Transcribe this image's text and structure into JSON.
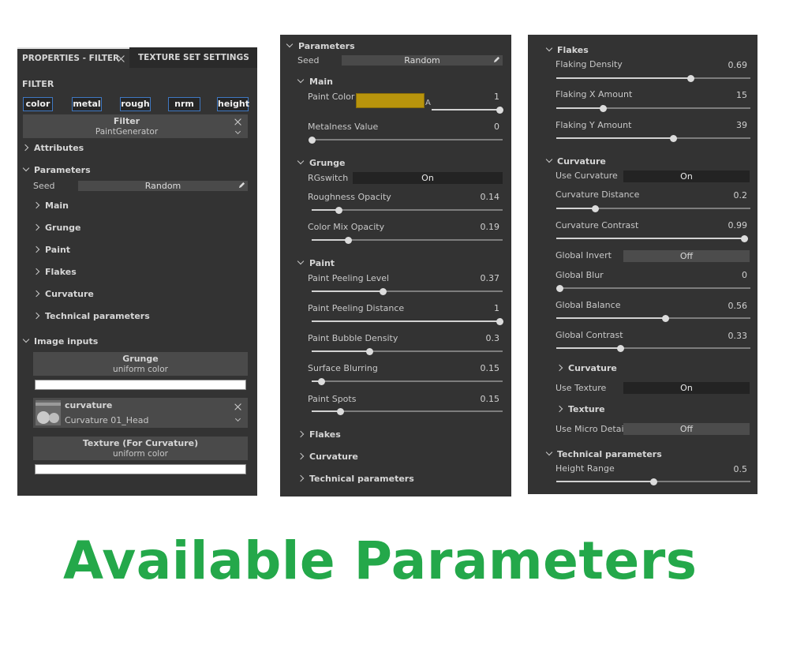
{
  "panel1": {
    "tabs": [
      "PROPERTIES - FILTER",
      "TEXTURE SET SETTINGS"
    ],
    "filter_heading": "FILTER",
    "channels": [
      "color",
      "metal",
      "rough",
      "nrm",
      "height"
    ],
    "filter_box": {
      "label": "Filter",
      "value": "PaintGenerator"
    },
    "sections": {
      "attributes": "Attributes",
      "parameters": "Parameters"
    },
    "seed": {
      "label": "Seed",
      "value": "Random"
    },
    "param_groups": [
      "Main",
      "Grunge",
      "Paint",
      "Flakes",
      "Curvature",
      "Technical parameters"
    ],
    "image_inputs": {
      "heading": "Image inputs",
      "grunge": {
        "title": "Grunge",
        "value": "uniform color"
      },
      "curvature": {
        "title": "curvature",
        "value": "Curvature 01_Head"
      },
      "texture": {
        "title": "Texture (For Curvature)",
        "value": "uniform color"
      }
    }
  },
  "panel2": {
    "parameters": "Parameters",
    "seed": {
      "label": "Seed",
      "value": "Random"
    },
    "main": {
      "heading": "Main",
      "paint_color": {
        "label": "Paint Color",
        "alpha_label": "A",
        "alpha_value": "1",
        "alpha": 1.0,
        "swatch": "#b8940c"
      },
      "metalness": {
        "label": "Metalness Value",
        "value": "0",
        "fraction": 0
      }
    },
    "grunge": {
      "heading": "Grunge",
      "rgswitch": {
        "label": "RGswitch",
        "value": "On"
      },
      "roughness_opacity": {
        "label": "Roughness Opacity",
        "value": "0.14",
        "fraction": 0.14
      },
      "color_mix_opacity": {
        "label": "Color Mix Opacity",
        "value": "0.19",
        "fraction": 0.19
      }
    },
    "paint": {
      "heading": "Paint",
      "peeling_level": {
        "label": "Paint Peeling Level",
        "value": "0.37",
        "fraction": 0.37
      },
      "peeling_distance": {
        "label": "Paint Peeling Distance",
        "value": "1",
        "fraction": 1.0
      },
      "bubble_density": {
        "label": "Paint Bubble Density",
        "value": "0.3",
        "fraction": 0.3
      },
      "surface_blurring": {
        "label": "Surface Blurring",
        "value": "0.15",
        "fraction": 0.05
      },
      "paint_spots": {
        "label": "Paint Spots",
        "value": "0.15",
        "fraction": 0.15
      }
    },
    "collapsed": [
      "Flakes",
      "Curvature",
      "Technical parameters"
    ]
  },
  "panel3": {
    "flakes": {
      "heading": "Flakes",
      "density": {
        "label": "Flaking Density",
        "value": "0.69",
        "fraction": 0.69
      },
      "x_amount": {
        "label": "Flaking X Amount",
        "value": "15",
        "fraction": 0.24
      },
      "y_amount": {
        "label": "Flaking Y Amount",
        "value": "39",
        "fraction": 0.6
      }
    },
    "curvature": {
      "heading": "Curvature",
      "use_curvature": {
        "label": "Use Curvature",
        "value": "On"
      },
      "distance": {
        "label": "Curvature Distance",
        "value": "0.2",
        "fraction": 0.2
      },
      "contrast": {
        "label": "Curvature Contrast",
        "value": "0.99",
        "fraction": 0.99
      },
      "global_invert": {
        "label": "Global Invert",
        "value": "Off"
      },
      "global_blur": {
        "label": "Global Blur",
        "value": "0",
        "fraction": 0
      },
      "global_balance": {
        "label": "Global Balance",
        "value": "0.56",
        "fraction": 0.56
      },
      "global_contrast": {
        "label": "Global Contrast",
        "value": "0.33",
        "fraction": 0.33
      },
      "sub_curvature": "Curvature",
      "use_texture": {
        "label": "Use Texture",
        "value": "On"
      },
      "sub_texture": "Texture",
      "use_micro": {
        "label": "Use Micro Details",
        "value": "Off"
      }
    },
    "technical": {
      "heading": "Technical parameters",
      "height_range": {
        "label": "Height Range",
        "value": "0.5",
        "fraction": 0.5
      }
    }
  },
  "caption": "Available Parameters"
}
